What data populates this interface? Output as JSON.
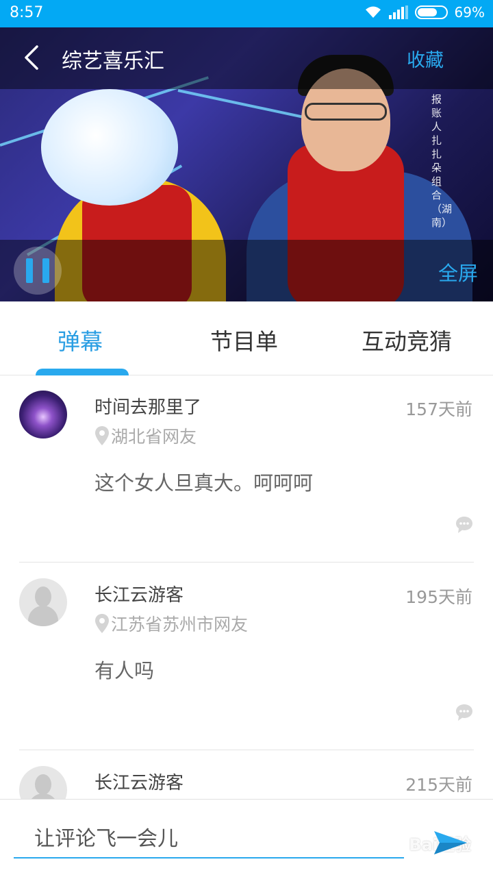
{
  "status_bar": {
    "time": "8:57",
    "battery_percent": "69%"
  },
  "video": {
    "title": "综艺喜乐汇",
    "favorite_label": "收藏",
    "fullscreen_label": "全屏",
    "overlay_caption": "报账人 扎扎朵组合（湖南）",
    "is_playing": true
  },
  "tabs": [
    {
      "label": "弹幕",
      "active": true
    },
    {
      "label": "节目单",
      "active": false
    },
    {
      "label": "互动竞猜",
      "active": false
    }
  ],
  "comments": [
    {
      "username": "时间去那里了",
      "time": "157天前",
      "location": "湖北省网友",
      "content": "这个女人旦真大。呵呵呵",
      "avatar": "storm-avatar"
    },
    {
      "username": "长江云游客",
      "time": "195天前",
      "location": "江苏省苏州市网友",
      "content": "有人吗",
      "avatar": "default-avatar"
    },
    {
      "username": "长江云游客",
      "time": "215天前",
      "location": "",
      "content": "",
      "avatar": "default-avatar"
    }
  ],
  "comment_input": {
    "placeholder": "让评论飞一会儿"
  },
  "watermark": "Bai经验",
  "colors": {
    "accent": "#29a9ee",
    "status_bar": "#03a9f4",
    "text_primary": "#444444",
    "text_secondary": "#999999"
  }
}
